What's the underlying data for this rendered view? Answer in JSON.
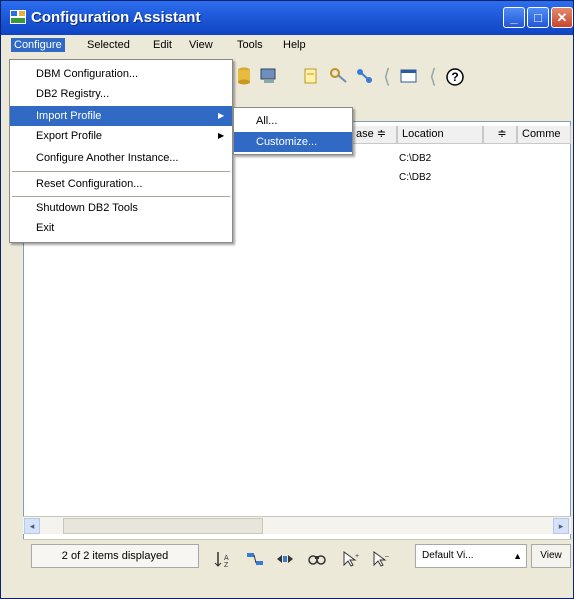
{
  "window": {
    "title": "Configuration Assistant"
  },
  "menubar": {
    "items": [
      {
        "label": "Configure"
      },
      {
        "label": "Selected"
      },
      {
        "label": "Edit"
      },
      {
        "label": "View"
      },
      {
        "label": "Tools"
      },
      {
        "label": "Help"
      }
    ]
  },
  "dropdown": {
    "items": [
      {
        "label": "DBM Configuration..."
      },
      {
        "label": "DB2 Registry..."
      },
      {
        "label": "Import Profile"
      },
      {
        "label": "Export Profile"
      },
      {
        "label": "Configure Another Instance..."
      },
      {
        "label": "Reset Configuration..."
      },
      {
        "label": "Shutdown DB2 Tools"
      },
      {
        "label": "Exit"
      }
    ]
  },
  "submenu": {
    "items": [
      {
        "label": "All..."
      },
      {
        "label": "Customize..."
      }
    ]
  },
  "table": {
    "columns": [
      "ase ≑",
      "Location",
      "≑",
      "Comme"
    ],
    "rows": [
      {
        "location": "C:\\DB2"
      },
      {
        "location": "C:\\DB2"
      }
    ]
  },
  "statusbar": {
    "count": "2 of 2 items displayed",
    "view_select": "Default Vi...",
    "view_button": "View"
  },
  "colors": {
    "titlebar": "#1d59d8",
    "highlight": "#316ac5",
    "face": "#ece9d8"
  },
  "icons": [
    "app-icon",
    "minimize-icon",
    "maximize-icon",
    "close-icon",
    "toolbar-icons",
    "sort-icon",
    "filter-icon",
    "find-icon",
    "select-all-icon",
    "deselect-icon"
  ]
}
